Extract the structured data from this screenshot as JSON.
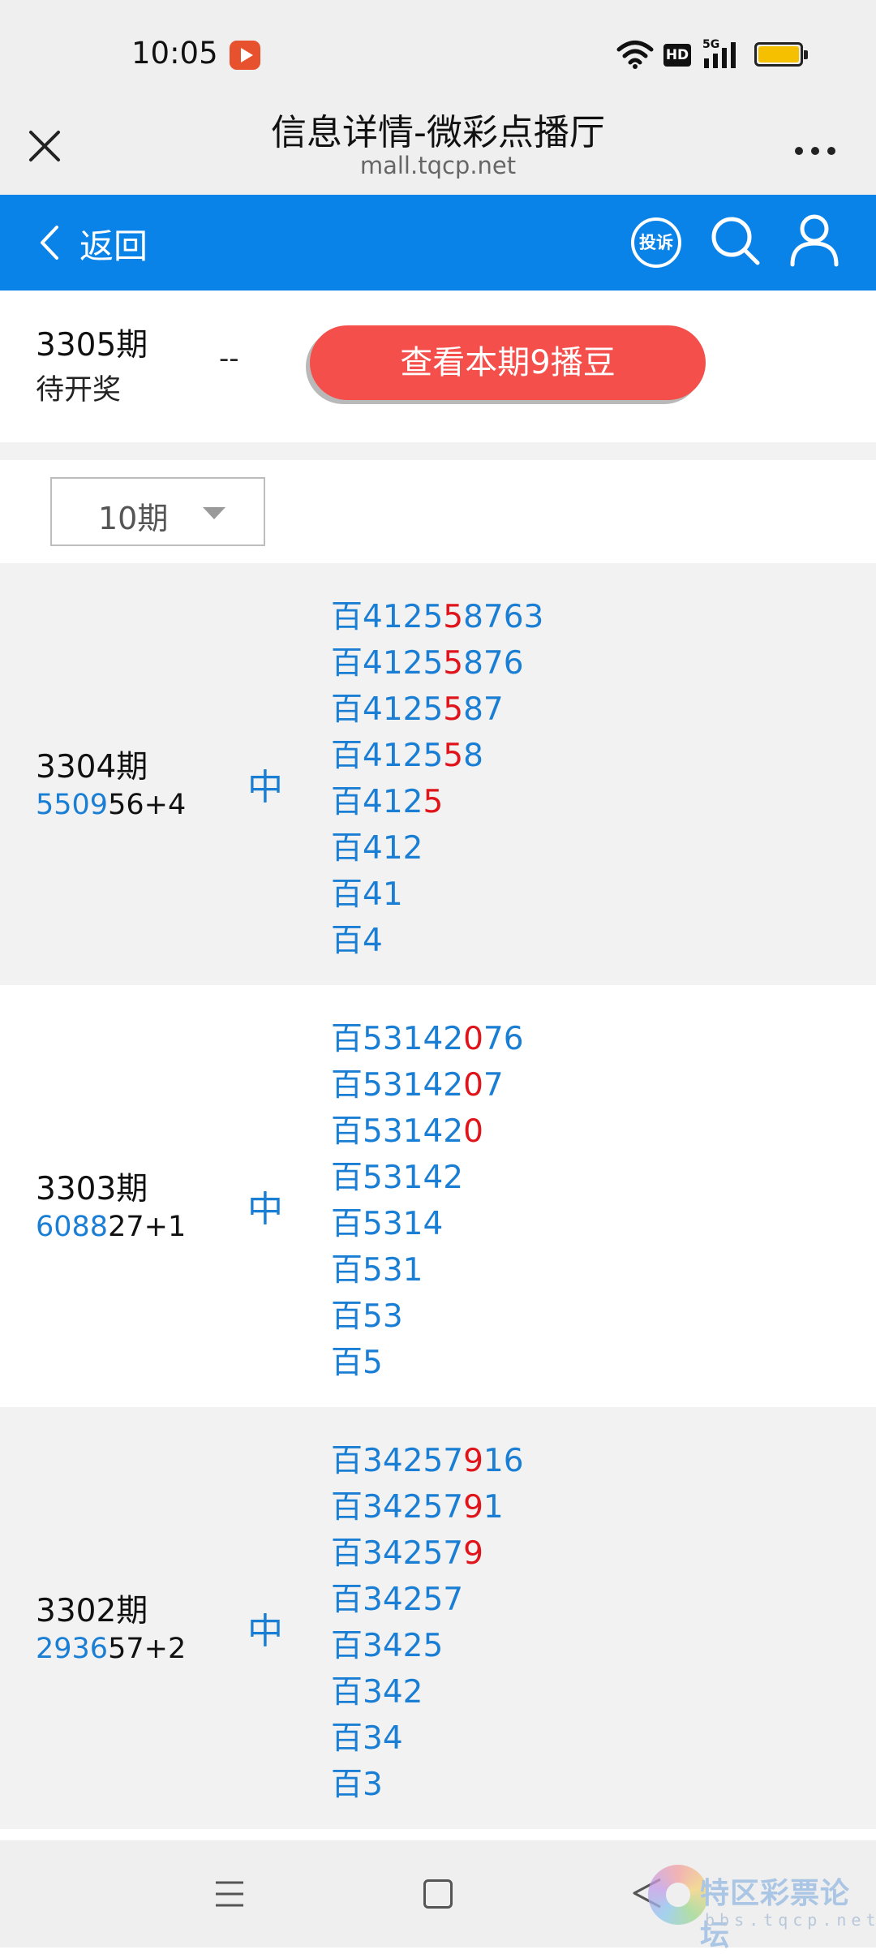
{
  "status_bar": {
    "time": "10:05",
    "network_badge": "HD",
    "network_type": "5G",
    "icons": [
      "recording-icon",
      "wifi-icon",
      "signal-icon",
      "battery-icon"
    ]
  },
  "browser": {
    "title": "信息详情-微彩点播厅",
    "url": "mall.tqcp.net"
  },
  "nav": {
    "back_label": "返回",
    "complaint_label": "投诉",
    "accent_color": "#0a83e8"
  },
  "current_issue": {
    "period": "3305期",
    "status": "待开奖",
    "result": "--",
    "view_button_label": "查看本期9播豆",
    "button_color": "#f44f4b"
  },
  "filter": {
    "selected": "10期"
  },
  "draws": [
    {
      "period": "3304期",
      "result_highlight": "5509",
      "result_rest": "56+4",
      "hit": "中",
      "predictions": [
        {
          "prefix": "百",
          "pre": "4125",
          "hit": "5",
          "post": "8763"
        },
        {
          "prefix": "百",
          "pre": "4125",
          "hit": "5",
          "post": "876"
        },
        {
          "prefix": "百",
          "pre": "4125",
          "hit": "5",
          "post": "87"
        },
        {
          "prefix": "百",
          "pre": "4125",
          "hit": "5",
          "post": "8"
        },
        {
          "prefix": "百",
          "pre": "412",
          "hit": "5",
          "post": ""
        },
        {
          "prefix": "百",
          "pre": "412",
          "hit": "",
          "post": ""
        },
        {
          "prefix": "百",
          "pre": "41",
          "hit": "",
          "post": ""
        },
        {
          "prefix": "百",
          "pre": "4",
          "hit": "",
          "post": ""
        }
      ]
    },
    {
      "period": "3303期",
      "result_highlight": "6088",
      "result_rest": "27+1",
      "hit": "中",
      "predictions": [
        {
          "prefix": "百",
          "pre": "53142",
          "hit": "0",
          "post": "76"
        },
        {
          "prefix": "百",
          "pre": "53142",
          "hit": "0",
          "post": "7"
        },
        {
          "prefix": "百",
          "pre": "53142",
          "hit": "0",
          "post": ""
        },
        {
          "prefix": "百",
          "pre": "53142",
          "hit": "",
          "post": ""
        },
        {
          "prefix": "百",
          "pre": "5314",
          "hit": "",
          "post": ""
        },
        {
          "prefix": "百",
          "pre": "531",
          "hit": "",
          "post": ""
        },
        {
          "prefix": "百",
          "pre": "53",
          "hit": "",
          "post": ""
        },
        {
          "prefix": "百",
          "pre": "5",
          "hit": "",
          "post": ""
        }
      ]
    },
    {
      "period": "3302期",
      "result_highlight": "2936",
      "result_rest": "57+2",
      "hit": "中",
      "predictions": [
        {
          "prefix": "百",
          "pre": "34257",
          "hit": "9",
          "post": "16"
        },
        {
          "prefix": "百",
          "pre": "34257",
          "hit": "9",
          "post": "1"
        },
        {
          "prefix": "百",
          "pre": "34257",
          "hit": "9",
          "post": ""
        },
        {
          "prefix": "百",
          "pre": "34257",
          "hit": "",
          "post": ""
        },
        {
          "prefix": "百",
          "pre": "3425",
          "hit": "",
          "post": ""
        },
        {
          "prefix": "百",
          "pre": "342",
          "hit": "",
          "post": ""
        },
        {
          "prefix": "百",
          "pre": "34",
          "hit": "",
          "post": ""
        },
        {
          "prefix": "百",
          "pre": "3",
          "hit": "",
          "post": ""
        }
      ]
    }
  ],
  "bottom_nav": {
    "icons": [
      "menu-icon",
      "home-icon",
      "back-icon"
    ]
  },
  "watermark": {
    "title": "特区彩票论坛",
    "domain": "bbs.tqcp.net"
  }
}
